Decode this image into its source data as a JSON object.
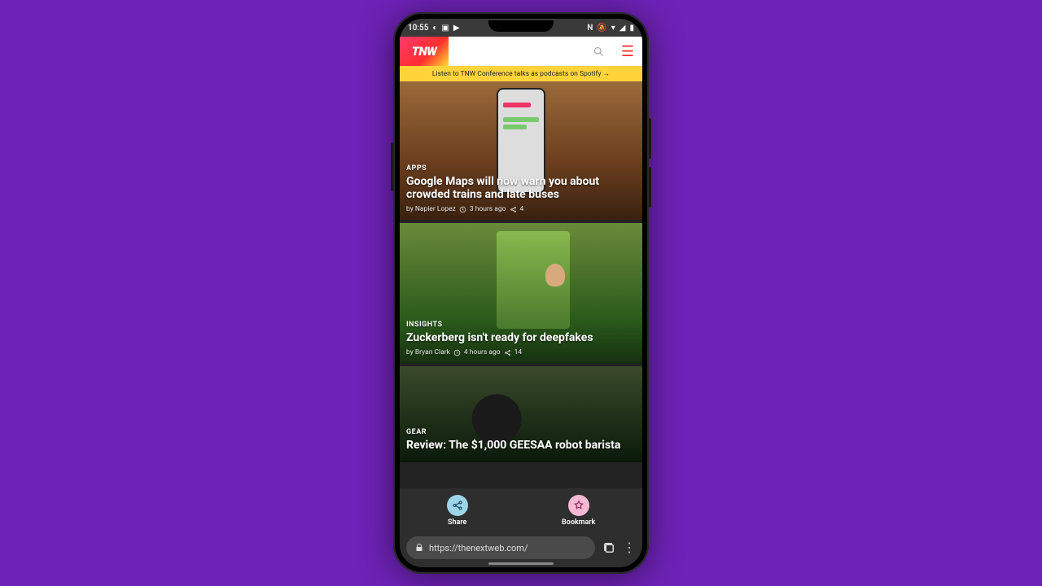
{
  "status": {
    "time": "10:55"
  },
  "header": {
    "logo": "TNW"
  },
  "banner": {
    "text": "Listen to TNW Conference talks as podcasts on Spotify →"
  },
  "articles": [
    {
      "category": "APPS",
      "title": "Google Maps will now warn you about crowded trains and late buses",
      "author": "by Napier Lopez",
      "time": "3 hours ago",
      "shares": "4"
    },
    {
      "category": "INSIGHTS",
      "title": "Zuckerberg isn't ready for deepfakes",
      "author": "by Bryan Clark",
      "time": "4 hours ago",
      "shares": "14"
    },
    {
      "category": "GEAR",
      "title": "Review: The $1,000 GEESAA robot barista"
    }
  ],
  "actions": {
    "share": "Share",
    "bookmark": "Bookmark"
  },
  "browser": {
    "url": "https://thenextweb.com/"
  }
}
